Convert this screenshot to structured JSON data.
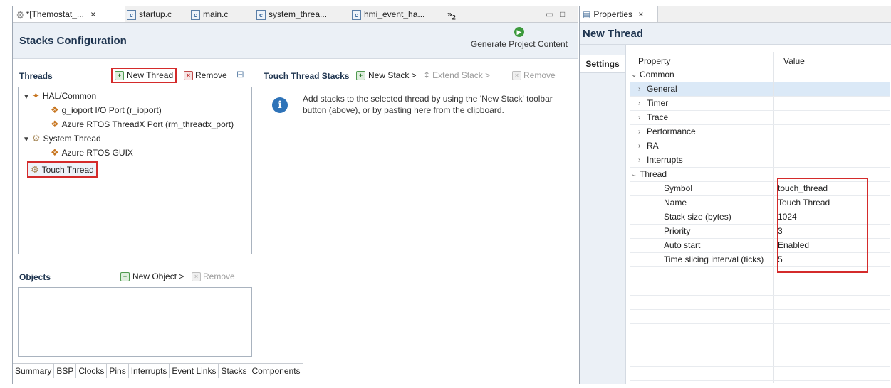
{
  "editor": {
    "tabs": [
      {
        "label": "*[Themostat_...",
        "close": "×",
        "icon": "gear-icon"
      },
      {
        "label": "startup.c",
        "icon": "c-file-icon"
      },
      {
        "label": "main.c",
        "icon": "c-file-icon"
      },
      {
        "label": "system_threa...",
        "icon": "c-file-icon"
      },
      {
        "label": "hmi_event_ha...",
        "icon": "c-file-icon"
      }
    ],
    "overflow_label": "»",
    "overflow_count": "2",
    "title": "Stacks Configuration",
    "generate_label": "Generate Project Content"
  },
  "threads": {
    "title": "Threads",
    "new_label": "New Thread",
    "remove_label": "Remove",
    "tree": [
      {
        "label": "HAL/Common",
        "level": 0,
        "expanded": true
      },
      {
        "label": "g_ioport I/O Port (r_ioport)",
        "level": 1
      },
      {
        "label": "Azure RTOS ThreadX Port (rm_threadx_port)",
        "level": 1
      },
      {
        "label": "System Thread",
        "level": 0,
        "expanded": true
      },
      {
        "label": "Azure RTOS GUIX",
        "level": 1
      },
      {
        "label": "Touch Thread",
        "level": 0,
        "selected": true
      }
    ]
  },
  "stacks": {
    "title": "Touch Thread Stacks",
    "new_label": "New Stack >",
    "extend_label": "Extend Stack >",
    "remove_label": "Remove",
    "info_text": "Add stacks to the selected thread by using the 'New Stack' toolbar button (above), or by pasting here from the clipboard."
  },
  "objects": {
    "title": "Objects",
    "new_label": "New Object >",
    "remove_label": "Remove"
  },
  "bottom_tabs": [
    "Summary",
    "BSP",
    "Clocks",
    "Pins",
    "Interrupts",
    "Event Links",
    "Stacks",
    "Components"
  ],
  "bottom_tabs_active": "Stacks",
  "properties": {
    "tab_label": "Properties",
    "close": "×",
    "title": "New Thread",
    "side_tab": "Settings",
    "col_property": "Property",
    "col_value": "Value",
    "rows": [
      {
        "name": "Common",
        "value": "",
        "indent": 0,
        "toggle": "v"
      },
      {
        "name": "General",
        "value": "",
        "indent": 1,
        "toggle": ">",
        "selected": true
      },
      {
        "name": "Timer",
        "value": "",
        "indent": 1,
        "toggle": ">"
      },
      {
        "name": "Trace",
        "value": "",
        "indent": 1,
        "toggle": ">"
      },
      {
        "name": "Performance",
        "value": "",
        "indent": 1,
        "toggle": ">"
      },
      {
        "name": "RA",
        "value": "",
        "indent": 1,
        "toggle": ">"
      },
      {
        "name": "Interrupts",
        "value": "",
        "indent": 1,
        "toggle": ">"
      },
      {
        "name": "Thread",
        "value": "",
        "indent": 0,
        "toggle": "v"
      },
      {
        "name": "Symbol",
        "value": "touch_thread",
        "indent": 2
      },
      {
        "name": "Name",
        "value": "Touch Thread",
        "indent": 2
      },
      {
        "name": "Stack size (bytes)",
        "value": "1024",
        "indent": 2
      },
      {
        "name": "Priority",
        "value": "3",
        "indent": 2
      },
      {
        "name": "Auto start",
        "value": "Enabled",
        "indent": 2
      },
      {
        "name": "Time slicing interval (ticks)",
        "value": "5",
        "indent": 2
      }
    ]
  },
  "colors": {
    "highlight_outline": "#d42b2b",
    "header_bg": "#ebf0f6",
    "selected_row": "#dbe9f7"
  }
}
